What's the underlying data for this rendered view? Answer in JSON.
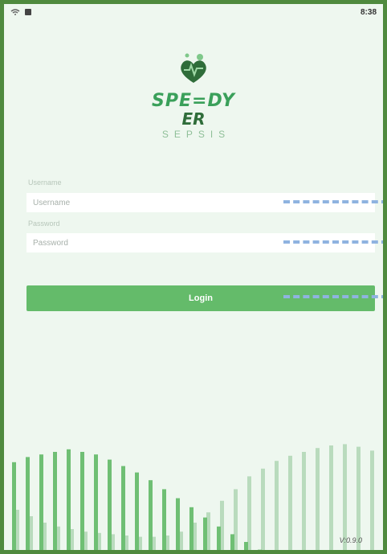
{
  "statusbar": {
    "time": "8:38",
    "icons": [
      "wifi-icon",
      "sim-icon"
    ]
  },
  "logo": {
    "line1": "SPE=DY",
    "line2": "ER",
    "line3": "SEPSIS",
    "icon": "heart-pulse-icon"
  },
  "form": {
    "username_label": "Username",
    "username_placeholder": "Username",
    "password_label": "Password",
    "password_placeholder": "Password",
    "login_label": "Login"
  },
  "footer": {
    "version": "V:0.9.0"
  },
  "colors": {
    "accent": "#64bb6a",
    "frame": "#4f8a3e",
    "background": "#eef7ef"
  },
  "decoration": {
    "bar_levels_dark": [
      0.72,
      0.76,
      0.78,
      0.8,
      0.82,
      0.8,
      0.78,
      0.74,
      0.69,
      0.64,
      0.58,
      0.51,
      0.44,
      0.37,
      0.29,
      0.22,
      0.16,
      0.1,
      0.04
    ],
    "bar_levels_light": [
      0.35,
      0.3,
      0.25,
      0.22,
      0.2,
      0.18,
      0.17,
      0.16,
      0.15,
      0.14,
      0.14,
      0.15,
      0.18,
      0.25,
      0.33,
      0.42,
      0.51,
      0.61,
      0.67,
      0.73,
      0.77,
      0.8,
      0.83,
      0.85,
      0.86,
      0.84,
      0.81,
      0.79
    ]
  }
}
